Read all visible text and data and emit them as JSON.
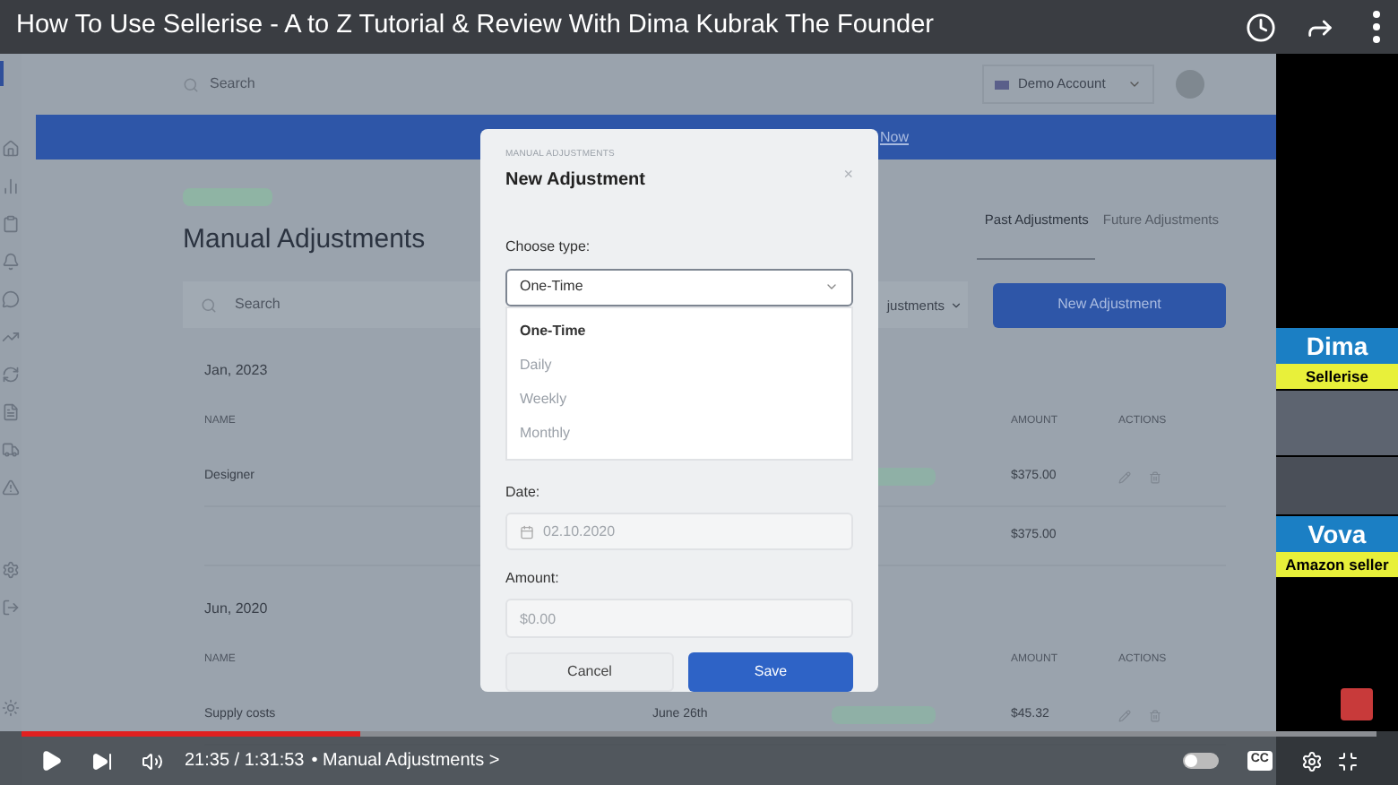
{
  "video": {
    "title": "How To Use Sellerise - A to Z Tutorial & Review With Dima Kubrak The Founder"
  },
  "app": {
    "search": {
      "placeholder": "Search"
    },
    "account": "Demo Account",
    "banner_link": "Now"
  },
  "page": {
    "title": "Manual Adjustments",
    "tabs": [
      {
        "label": "Past Adjustments",
        "selected": true
      },
      {
        "label": "Future Adjustments",
        "selected": false
      }
    ],
    "search": {
      "placeholder": "Search"
    },
    "filter": "justments",
    "new_button": "New Adjustment"
  },
  "sections": [
    {
      "heading": "Jan, 2023",
      "name_header": "NAME",
      "amount_header": "AMOUNT",
      "actions_header": "ACTIONS",
      "rows": [
        {
          "name": "Designer",
          "badge": true,
          "amount": "$375.00",
          "has_actions": true
        },
        {
          "badge": false,
          "amount": "$375.00",
          "has_actions": false
        }
      ]
    },
    {
      "heading": "Jun, 2020",
      "name_header": "NAME",
      "amount_header": "AMOUNT",
      "actions_header": "ACTIONS",
      "rows": [
        {
          "name": "Supply costs",
          "date": "June 26th",
          "badge": true,
          "amount": "$45.32",
          "has_actions": true
        }
      ]
    }
  ],
  "modal": {
    "eyebrow": "MANUAL ADJUSTMENTS",
    "title": "New Adjustment",
    "close": "×",
    "type_label": "Choose type:",
    "type_value": "One-Time",
    "options": [
      {
        "label": "One-Time",
        "selected": true
      },
      {
        "label": "Daily",
        "selected": false
      },
      {
        "label": "Weekly",
        "selected": false
      },
      {
        "label": "Monthly",
        "selected": false
      }
    ],
    "date_label": "Date:",
    "date_value": "02.10.2020",
    "amount_label": "Amount:",
    "amount_placeholder": "$0.00",
    "cancel": "Cancel",
    "save": "Save"
  },
  "hosts": [
    {
      "name": "Dima",
      "role": "Sellerise"
    },
    {
      "name": "Vova",
      "role": "Amazon seller"
    }
  ],
  "player": {
    "level": 0.25,
    "time": "21:35 / 1:31:53",
    "chapter": "• Manual Adjustments >",
    "cc": "CC",
    "autoplay": false
  }
}
